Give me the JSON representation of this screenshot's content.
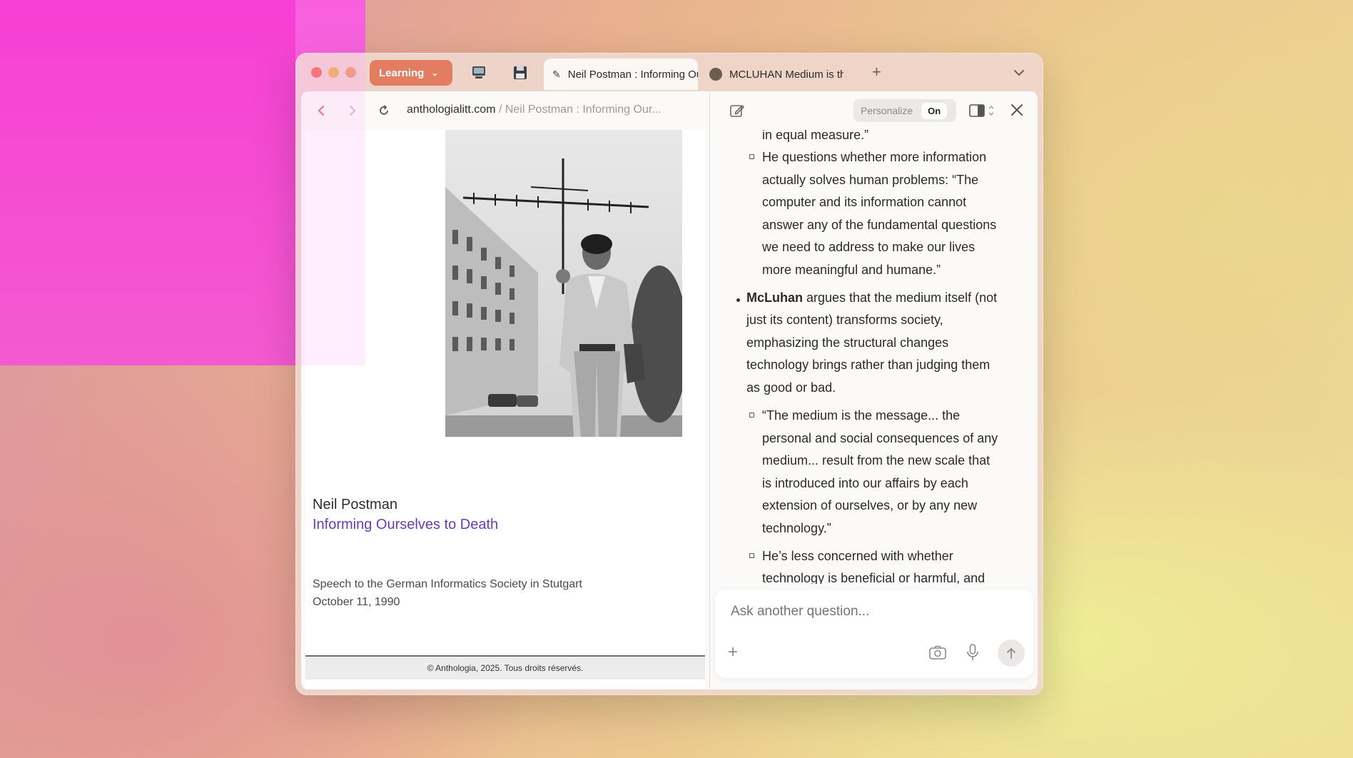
{
  "browser": {
    "space_label": "Learning",
    "tabs": [
      {
        "title": "Neil Postman : Informing Ourselves to Death",
        "active": true
      },
      {
        "title": "MCLUHAN Medium is the Message",
        "active": false
      }
    ],
    "new_tab_label": "+"
  },
  "address": {
    "domain": "anthologialitt.com",
    "path": " / Neil Postman : Informing Our..."
  },
  "page": {
    "author": "Neil Postman",
    "title": "Informing Ourselves to Death",
    "subtitle_line1": "Speech to the German Informatics Society in Stutgart",
    "subtitle_line2": "October 11, 1990",
    "footer": "© Anthologia, 2025. Tous droits réservés."
  },
  "assistant": {
    "personalize_label": "Personalize",
    "toggle_label": "On",
    "lines": {
      "l0": "in equal measure.”",
      "l1": "He questions whether more information",
      "l2": "actually solves human problems: “The",
      "l3": "computer and its information cannot",
      "l4": "answer any of the fundamental questions",
      "l5": "we need to address to make our lives",
      "l6": "more meaningful and humane.”",
      "l7_bold": "McLuhan",
      "l7_rest": " argues that the medium itself (not",
      "l8": "just its content) transforms society,",
      "l9": "emphasizing the structural changes",
      "l10": "technology brings rather than judging them",
      "l11": "as good or bad.",
      "l12": "“The medium is the message... the",
      "l13": "personal and social consequences of any",
      "l14": "medium... result from the new scale that",
      "l15": "is introduced into our affairs by each",
      "l16": "extension of ourselves, or by any new",
      "l17": "technology.”",
      "l18": "He’s less concerned with whether",
      "l19": "technology is beneficial or harmful, and"
    },
    "ask_placeholder": "Ask another question..."
  },
  "colors": {
    "accent": "#e37d62",
    "link": "#6a3bb5",
    "background_pink": "#f63fd4"
  },
  "icons": [
    "back-arrow-icon",
    "forward-arrow-icon",
    "reload-icon",
    "edit-icon",
    "sidebar-icon",
    "close-icon",
    "camera-icon",
    "microphone-icon",
    "send-arrow-icon",
    "plus-icon"
  ]
}
